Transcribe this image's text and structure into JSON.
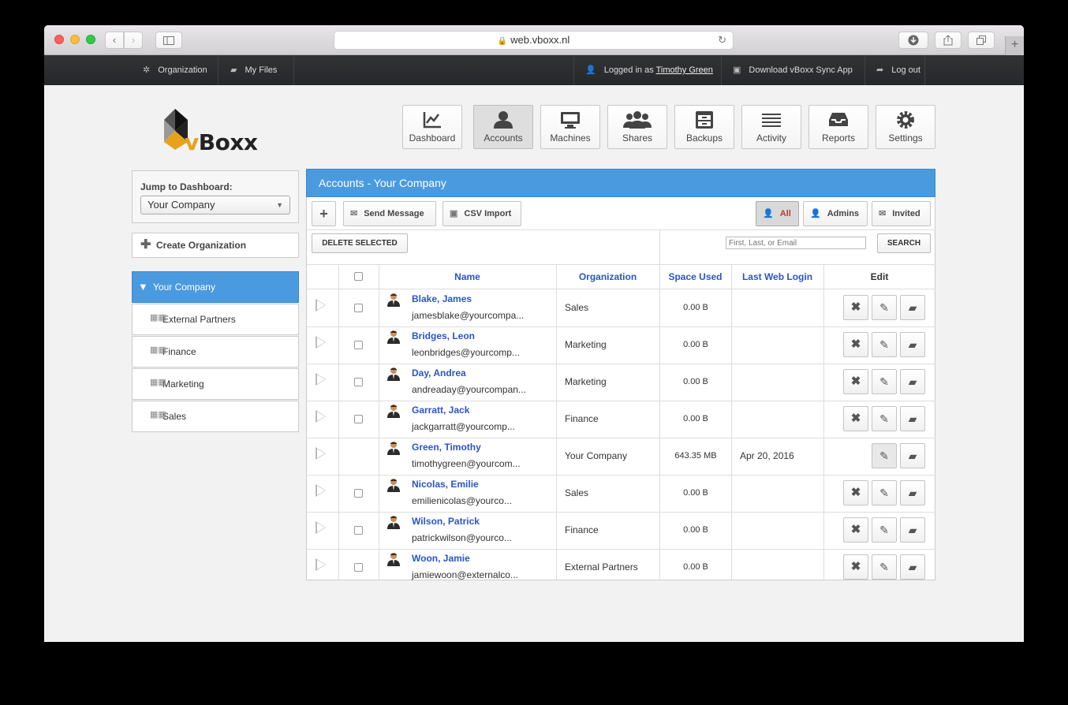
{
  "browser": {
    "url": "web.vboxx.nl",
    "back_icon": "chevron-left-icon",
    "forward_icon": "chevron-right-icon"
  },
  "topbar": {
    "organization": "Organization",
    "my_files": "My Files",
    "logged_in_prefix": "Logged in as",
    "user": "Timothy Green",
    "download": "Download vBoxx Sync App",
    "logout": "Log out"
  },
  "logo": {
    "brand_v": "v",
    "brand_rest": "Boxx"
  },
  "nav": [
    {
      "label": "Dashboard",
      "icon": "chart-icon"
    },
    {
      "label": "Accounts",
      "icon": "user-icon",
      "active": true
    },
    {
      "label": "Machines",
      "icon": "monitor-icon"
    },
    {
      "label": "Shares",
      "icon": "group-icon"
    },
    {
      "label": "Backups",
      "icon": "archive-icon"
    },
    {
      "label": "Activity",
      "icon": "list-icon"
    },
    {
      "label": "Reports",
      "icon": "inbox-icon"
    },
    {
      "label": "Settings",
      "icon": "gear-icon"
    }
  ],
  "sidebar": {
    "jump_label": "Jump to Dashboard:",
    "jump_value": "Your Company",
    "create_org": "Create Organization",
    "root": "Your Company",
    "orgs": [
      "External Partners",
      "Finance",
      "Marketing",
      "Sales"
    ]
  },
  "panel": {
    "title": "Accounts - Your Company",
    "send_message": "Send Message",
    "csv_import": "CSV Import",
    "filter_all": "All",
    "filter_admins": "Admins",
    "filter_invited": "Invited",
    "delete_selected": "DELETE SELECTED",
    "search_placeholder": "First, Last, or Email",
    "search_button": "SEARCH",
    "columns": {
      "name": "Name",
      "organization": "Organization",
      "space_used": "Space Used",
      "last_web_login": "Last Web Login",
      "edit": "Edit"
    }
  },
  "accounts": [
    {
      "name": "Blake, James",
      "email": "jamesblake@yourcompa...",
      "org": "Sales",
      "space": "0.00 B",
      "last_login": "",
      "deletable": true
    },
    {
      "name": "Bridges, Leon",
      "email": "leonbridges@yourcomp...",
      "org": "Marketing",
      "space": "0.00 B",
      "last_login": "",
      "deletable": true
    },
    {
      "name": "Day, Andrea",
      "email": "andreaday@yourcompan...",
      "org": "Marketing",
      "space": "0.00 B",
      "last_login": "",
      "deletable": true
    },
    {
      "name": "Garratt, Jack",
      "email": "jackgarratt@yourcomp...",
      "org": "Finance",
      "space": "0.00 B",
      "last_login": "",
      "deletable": true
    },
    {
      "name": "Green, Timothy",
      "email": "timothygreen@yourcom...",
      "org": "Your Company",
      "space": "643.35 MB",
      "last_login": "Apr 20, 2016",
      "deletable": false
    },
    {
      "name": "Nicolas, Emilie",
      "email": "emilienicolas@yourco...",
      "org": "Sales",
      "space": "0.00 B",
      "last_login": "",
      "deletable": true
    },
    {
      "name": "Wilson, Patrick",
      "email": "patrickwilson@yourco...",
      "org": "Finance",
      "space": "0.00 B",
      "last_login": "",
      "deletable": true
    },
    {
      "name": "Woon, Jamie",
      "email": "jamiewoon@externalco...",
      "org": "External Partners",
      "space": "0.00 B",
      "last_login": "",
      "deletable": true
    }
  ]
}
